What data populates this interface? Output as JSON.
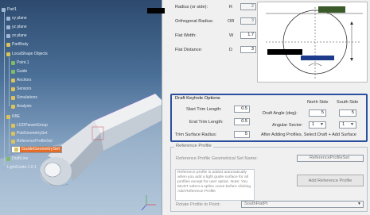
{
  "tree": {
    "items": [
      {
        "label": "Part1",
        "icon": "part-icon"
      },
      {
        "label": "xy plane",
        "icon": "plane-icon"
      },
      {
        "label": "yz plane",
        "icon": "plane-icon"
      },
      {
        "label": "zx plane",
        "icon": "plane-icon"
      },
      {
        "label": "PartBody",
        "icon": "body-icon"
      },
      {
        "label": "LocalShape Objects",
        "icon": "folder-icon"
      },
      {
        "label": "Point.1",
        "icon": "point-icon"
      },
      {
        "label": "Guide",
        "icon": "curve-icon"
      },
      {
        "label": "Anchors",
        "icon": "set-icon"
      },
      {
        "label": "Sensors",
        "icon": "set-icon"
      },
      {
        "label": "Simulations",
        "icon": "set-icon"
      },
      {
        "label": "Analysis",
        "icon": "set-icon"
      },
      {
        "label": "KBE",
        "icon": "set-icon"
      },
      {
        "label": "LGDParamGroup",
        "icon": "set-icon"
      },
      {
        "label": "PubGeometrySet",
        "icon": "set-icon"
      },
      {
        "label": "ReferenceProfileSet",
        "icon": "set-icon"
      },
      {
        "label": "GuideGeometrySet",
        "icon": "set-icon",
        "selected": true
      },
      {
        "label": "DraftLine",
        "icon": "curve-icon"
      },
      {
        "label": "LightGuide.1.0.1",
        "icon": "part-icon"
      }
    ]
  },
  "params": {
    "radius": {
      "label": "Radius (or side):",
      "sym": "R",
      "value": "2"
    },
    "ortho": {
      "label": "Orthogonal Radius:",
      "sym": "OR",
      "value": "3"
    },
    "flat_width": {
      "label": "Flat Width:",
      "sym": "W",
      "value": "1.7"
    },
    "flat_distance": {
      "label": "Flat Distance:",
      "sym": "D",
      "value": "3"
    }
  },
  "keyhole": {
    "title": "Draft Keyhole Options",
    "start_trim": {
      "label": "Start Trim Length:",
      "value": "0.5"
    },
    "end_trim": {
      "label": "End Trim Length:",
      "value": "0.5"
    },
    "trim_surface_radius": {
      "label": "Trim Surface Radius:",
      "value": "5"
    },
    "col_north": "North Side",
    "col_south": "South Side",
    "draft_angle": {
      "label": "Draft Angle (deg):",
      "north": "5",
      "south": "5"
    },
    "angular_sector": {
      "label": "Angular Sector:",
      "north": "1",
      "south": "1"
    },
    "hint": "After Adding Profiles, Select Draft + Add Surface"
  },
  "reference": {
    "title": "Reference Profile",
    "geom_set_label": "Reference Profile Geometrical Set Name:",
    "geom_set_value": "ReferenceProfileSet",
    "note": "Reference profile is added automatically when you add a light guide surface for all profiles except for user option. Note: You MUST select a spline curve before clicking Add Reference Profile",
    "add_button": "Add Reference Profile",
    "rotate_label": "Rotate Profile to Point:",
    "rotate_value": "SouthFlatPt"
  }
}
